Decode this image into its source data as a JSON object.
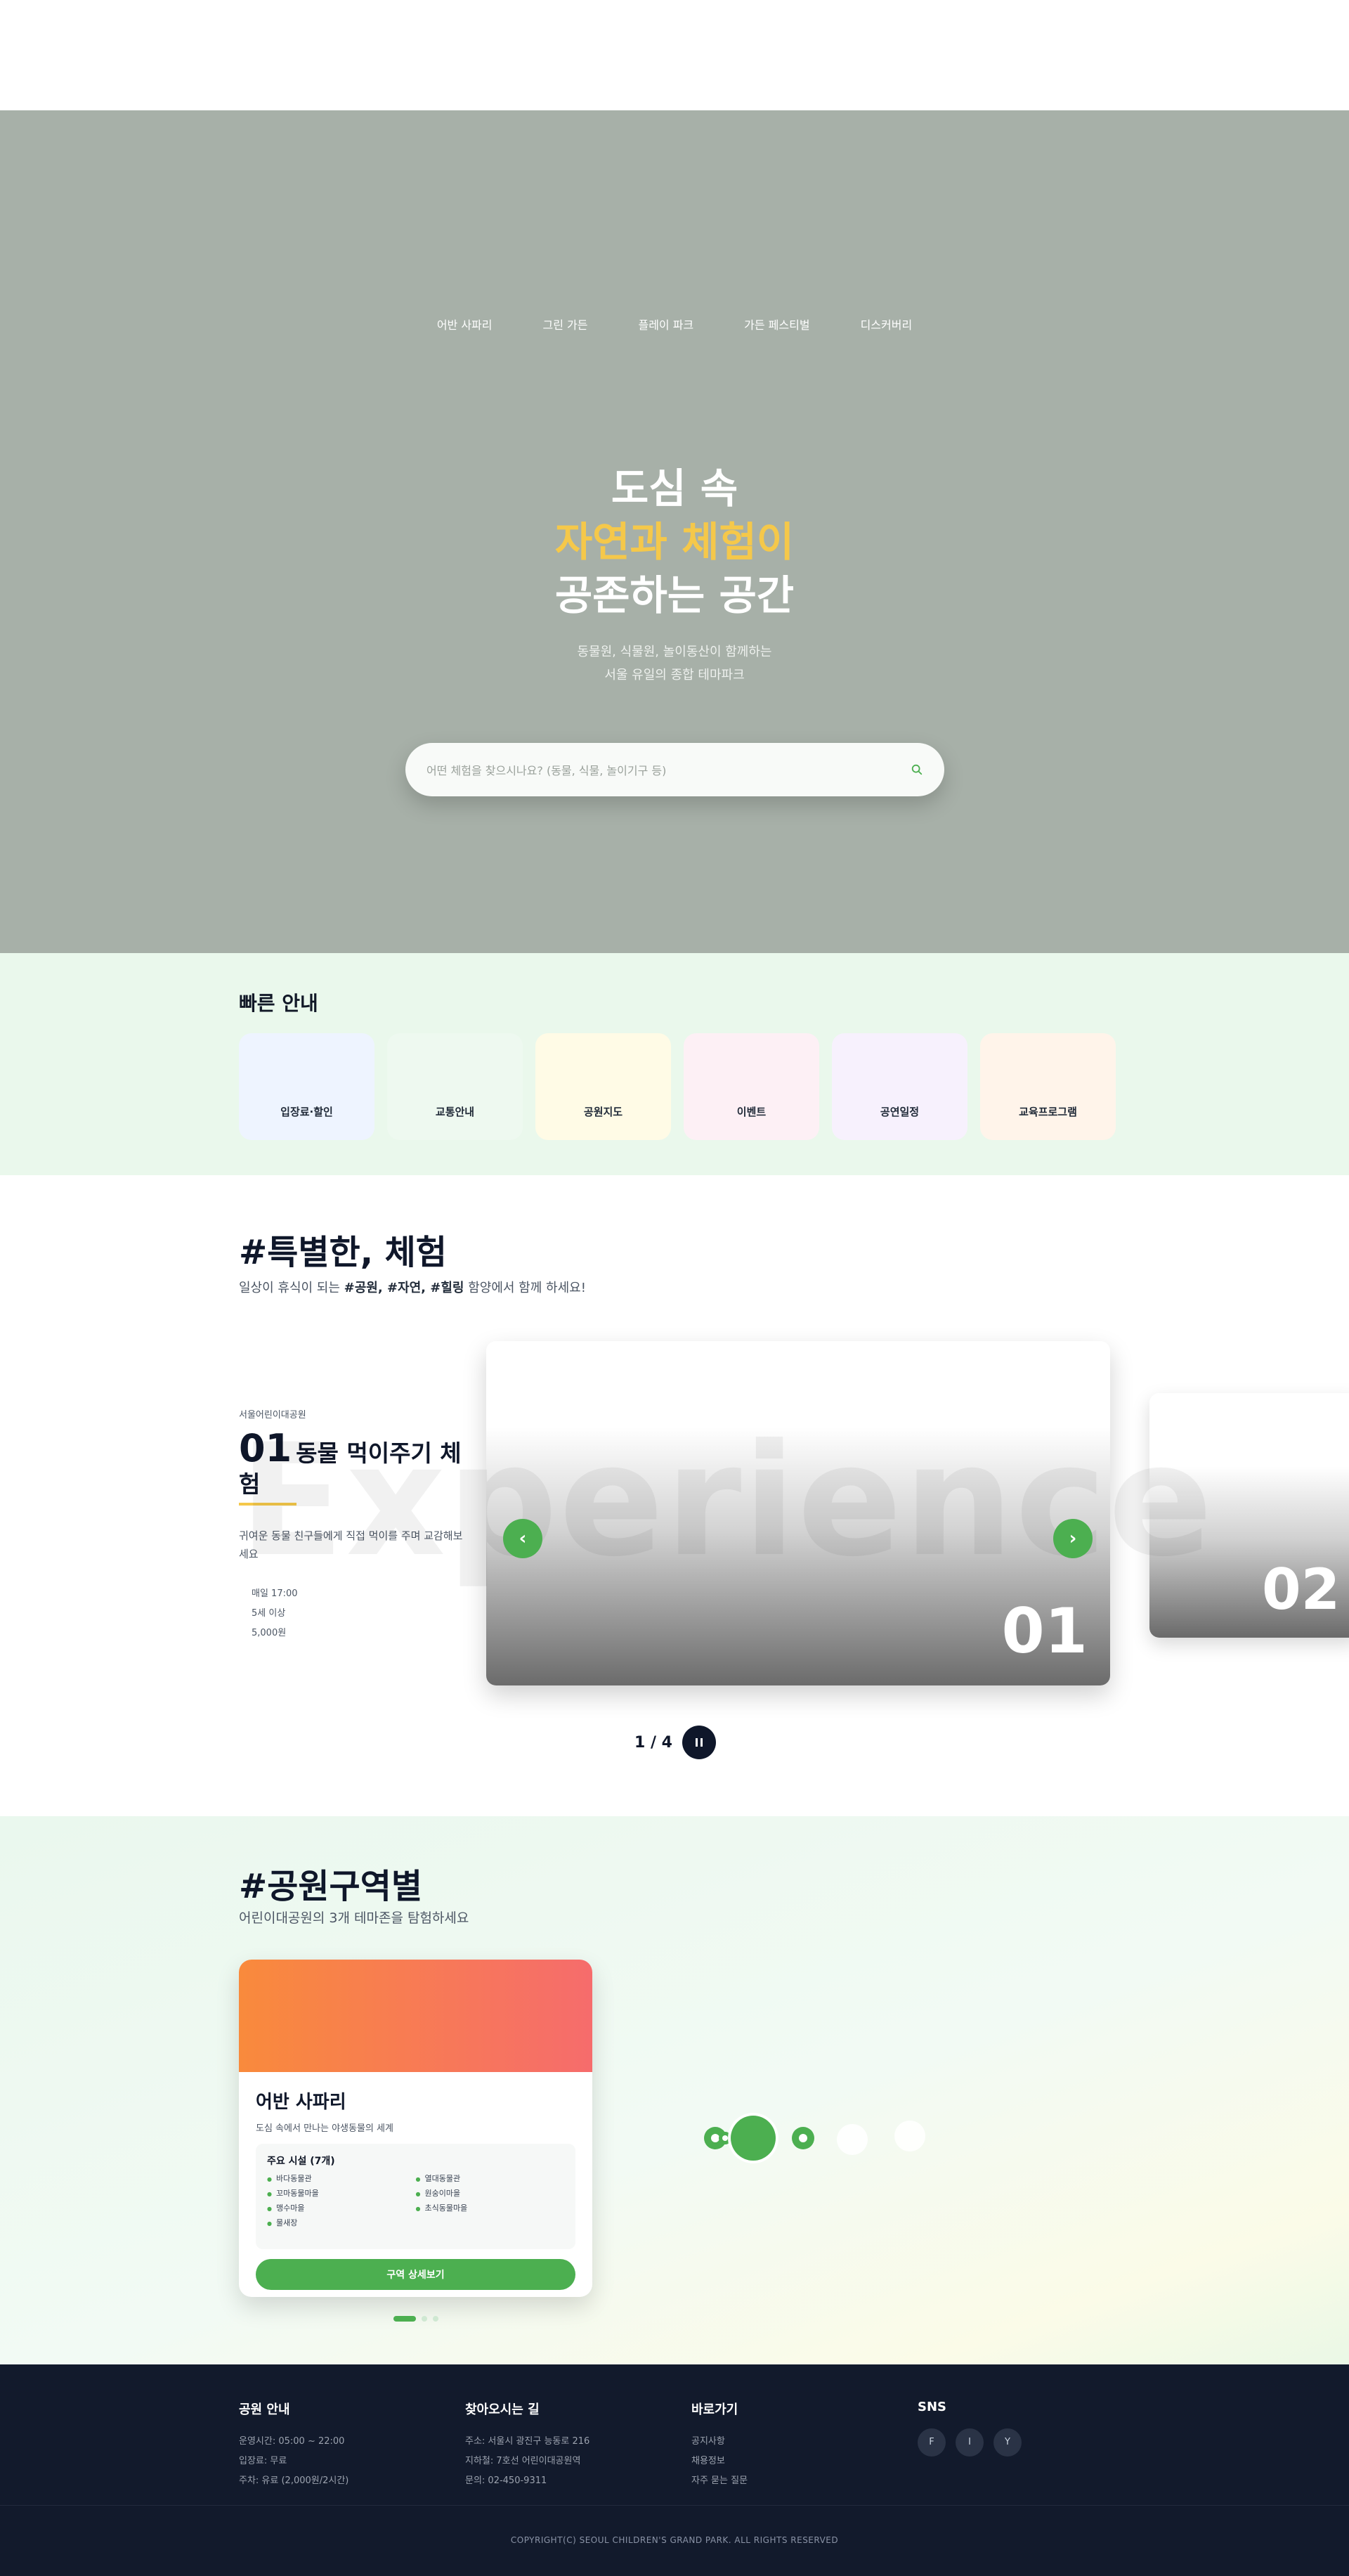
{
  "hero": {
    "nav": [
      "어반 사파리",
      "그린 가든",
      "플레이 파크",
      "가든 페스티벌",
      "디스커버리"
    ],
    "title_line1": "도심 속",
    "title_line2": "자연과 체험이",
    "title_line3": "공존하는 공간",
    "subtitle_line1": "동물원, 식물원, 놀이동산이 함께하는",
    "subtitle_line2": "서울 유일의 종합 테마파크",
    "search_placeholder": "어떤 체험을 찾으시나요? (동물, 식물, 놀이기구 등)"
  },
  "quick": {
    "title": "빠른 안내",
    "items": [
      {
        "label": "입장료·할인",
        "color": "#eef4ff"
      },
      {
        "label": "교통안내",
        "color": "#eef9f0"
      },
      {
        "label": "공원지도",
        "color": "#fffbe6"
      },
      {
        "label": "이벤트",
        "color": "#fdf0f5"
      },
      {
        "label": "공연일정",
        "color": "#f7f1fd"
      },
      {
        "label": "교육프로그램",
        "color": "#fff4ea"
      }
    ]
  },
  "experience": {
    "title": "#특별한, 체험",
    "subtitle_pre": "일상이 휴식이 되는 ",
    "subtitle_tags": "#공원, #자연, #힐링",
    "subtitle_post": " 함양에서 함께 하세요!",
    "bigword": "Experience",
    "org": "서울어린이대공원",
    "number": "01",
    "name": "동물 먹이주기 체험",
    "desc": "귀여운 동물 친구들에게 직접 먹이를 주며 교감해보세요",
    "meta": [
      "매일 17:00",
      "5세 이상",
      "5,000원"
    ],
    "slide_num": "01",
    "next_slide_num": "02",
    "pager": "1 / 4"
  },
  "zones": {
    "title": "#공원구역별",
    "subtitle": "어린이대공원의 3개 테마존을 탐험하세요",
    "card": {
      "title": "어반 사파리",
      "desc": "도심 속에서 만나는 야생동물의 세계",
      "facilities_title": "주요 시설 (7개)",
      "facilities": [
        "바다동물관",
        "열대동물관",
        "꼬마동물마을",
        "원숭이마을",
        "맹수마을",
        "초식동물마을",
        "물새장"
      ],
      "button": "구역 상세보기"
    }
  },
  "footer": {
    "info_title": "공원 안내",
    "info": [
      "운영시간: 05:00 ~ 22:00",
      "입장료: 무료",
      "주차: 유료 (2,000원/2시간)"
    ],
    "dir_title": "찾아오시는 길",
    "dir": [
      "주소: 서울시 광진구 능동로 216",
      "지하철: 7호선 어린이대공원역",
      "문의: 02-450-9311"
    ],
    "links_title": "바로가기",
    "links": [
      "공지사항",
      "채용정보",
      "자주 묻는 질문"
    ],
    "sns_title": "SNS",
    "sns": [
      "F",
      "I",
      "Y"
    ],
    "copyright": "COPYRIGHT(C) SEOUL CHILDREN'S GRAND PARK. ALL RIGHTS RESERVED"
  }
}
